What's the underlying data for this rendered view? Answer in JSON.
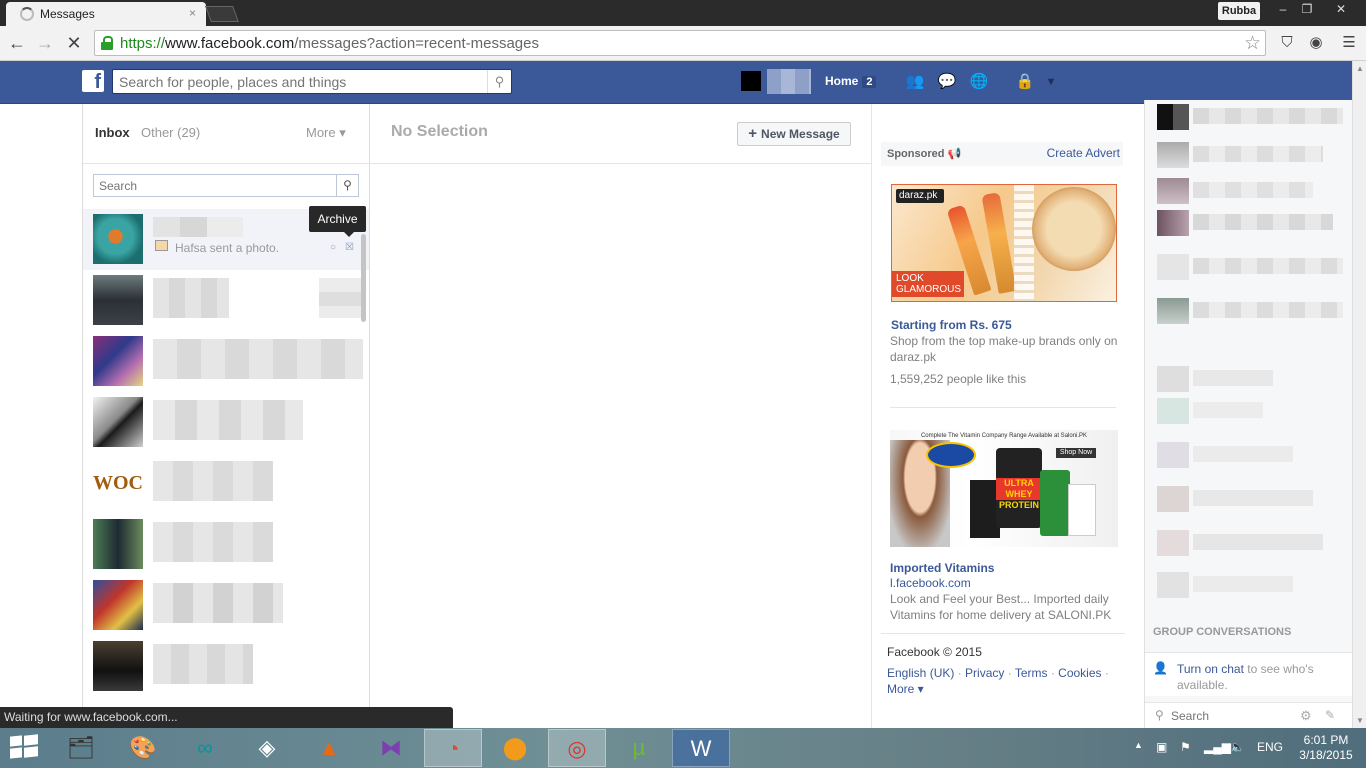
{
  "browser": {
    "tab_title": "Messages",
    "tab_close": "×",
    "user_name": "Rubba",
    "url_scheme": "https://",
    "url_host": "www.facebook.com",
    "url_path": "/messages?action=recent-messages",
    "status_text": "Waiting for www.facebook.com...",
    "window_min": "–",
    "window_restore": "❐",
    "window_close": "✕"
  },
  "fb_header": {
    "logo": "f",
    "search_placeholder": "Search for people, places and things",
    "home_label": "Home",
    "home_count": "2"
  },
  "messages": {
    "inbox_label": "Inbox",
    "other_label": "Other (29)",
    "more_label": "More ▾",
    "search_placeholder": "Search",
    "tooltip": "Archive",
    "threads": [
      {
        "snippet": "Hafsa sent a photo."
      }
    ],
    "main_title": "No Selection",
    "new_message_label": "New Message"
  },
  "ads": {
    "sponsored_label": "Sponsored",
    "create_advert": "Create Advert",
    "ad1": {
      "logo_text": "daraz.pk",
      "tag_text": "LOOK GLAMOROUS",
      "title": "Starting from Rs. 675",
      "body": "Shop from the top make-up brands only on daraz.pk",
      "likes": "1,559,252 people like this"
    },
    "ad2": {
      "header_text": "Complete The Vitamin Company Range Available at Saloni.PK",
      "product_label": "ULTRA WHEY PROTEIN",
      "shop_now": "Shop Now",
      "title": "Imported Vitamins",
      "domain": "l.facebook.com",
      "body": "Look and Feel your Best... Imported daily Vitamins for home delivery at SALONI.PK"
    },
    "footer": {
      "copyright": "Facebook © 2015",
      "links": [
        "English (UK)",
        "Privacy",
        "Terms",
        "Cookies"
      ],
      "more": "More ▾"
    }
  },
  "chat": {
    "group_conversations": "GROUP CONVERSATIONS",
    "turn_on_link": "Turn on chat",
    "turn_on_rest": " to see who's available.",
    "search_placeholder": "Search"
  },
  "taskbar": {
    "language": "ENG",
    "time": "6:01 PM",
    "date": "3/18/2015"
  },
  "colors": {
    "facebook_blue": "#3b5998",
    "link_blue": "#3b5998",
    "chrome_dark": "#2b2b2b"
  }
}
